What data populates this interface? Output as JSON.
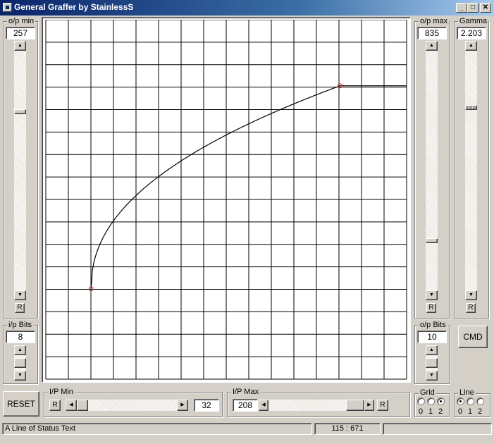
{
  "window": {
    "title": "General Graffer  by StainlessS",
    "minimize_glyph": "_",
    "maximize_glyph": "□",
    "close_glyph": "✕"
  },
  "op_min": {
    "label": "o/p min",
    "value": "257",
    "reset_label": "R",
    "level_fraction": 0.75
  },
  "op_max": {
    "label": "o/p max",
    "value": "835",
    "reset_label": "R",
    "level_fraction": 0.2
  },
  "gamma": {
    "label": "Gamma",
    "value": "2.203",
    "reset_label": "R",
    "level_fraction": 0.77
  },
  "ip_bits": {
    "label": "i/p Bits",
    "value": "8"
  },
  "op_bits": {
    "label": "o/p Bits",
    "value": "10"
  },
  "cmd_button": {
    "label": "CMD"
  },
  "reset_button": {
    "label": "RESET"
  },
  "ip_min": {
    "label": "I/P Min",
    "value": "32",
    "reset_label": "R",
    "position_fraction": 0.0
  },
  "ip_max": {
    "label": "I/P Max",
    "value": "208",
    "reset_label": "R",
    "position_fraction": 1.0
  },
  "grid_options": {
    "label": "Grid",
    "options": [
      "0",
      "1",
      "2"
    ],
    "selected": 2
  },
  "line_options": {
    "label": "Line",
    "options": [
      "0",
      "1",
      "2"
    ],
    "selected": 0
  },
  "status": {
    "text": "A Line of Status Text",
    "coords": "115 : 671"
  },
  "colors": {
    "titlebar": "#0a246a",
    "face": "#d4d0c8",
    "grid_line": "#000000",
    "curve": "#000000",
    "marker": "#cc3333"
  },
  "chart_data": {
    "type": "line",
    "xlim": [
      0,
      255
    ],
    "ylim": [
      0,
      1023
    ],
    "grid_divisions": 16,
    "input_min": 32,
    "input_max": 208,
    "output_min": 257,
    "output_max": 835,
    "gamma": 2.203
  }
}
